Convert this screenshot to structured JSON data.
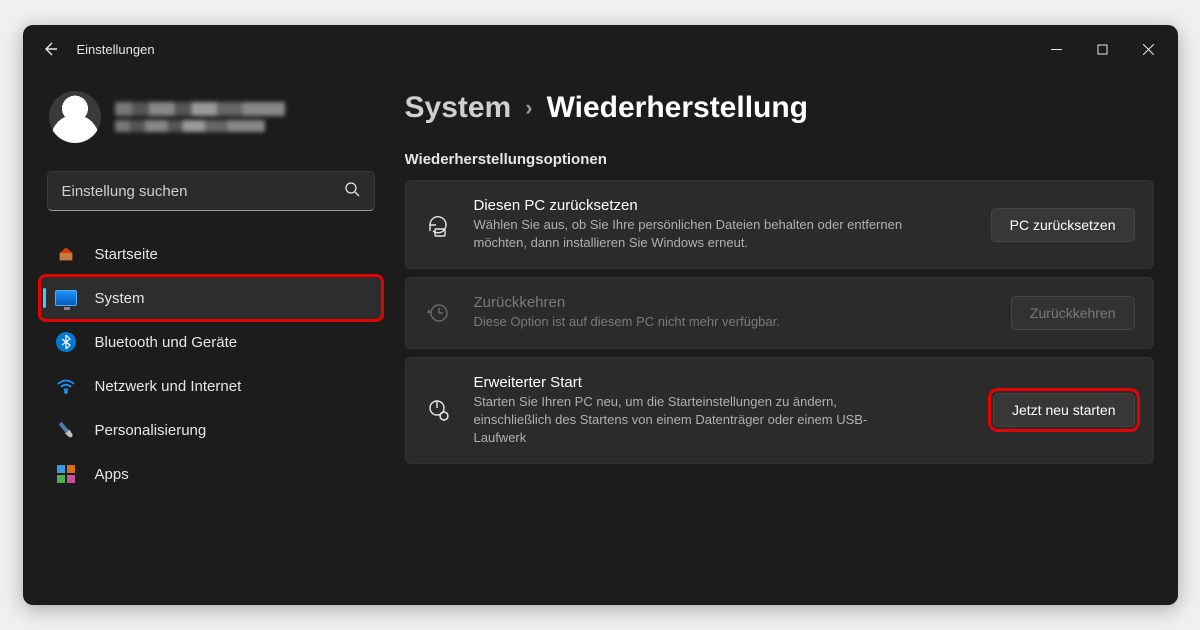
{
  "app": {
    "title": "Einstellungen"
  },
  "search": {
    "placeholder": "Einstellung suchen"
  },
  "nav": {
    "home": "Startseite",
    "system": "System",
    "bluetooth": "Bluetooth und Geräte",
    "network": "Netzwerk und Internet",
    "personalization": "Personalisierung",
    "apps": "Apps"
  },
  "breadcrumb": {
    "parent": "System",
    "current": "Wiederherstellung"
  },
  "section": {
    "title": "Wiederherstellungsoptionen"
  },
  "cards": {
    "reset": {
      "title": "Diesen PC zurücksetzen",
      "desc": "Wählen Sie aus, ob Sie Ihre persönlichen Dateien behalten oder entfernen möchten, dann installieren Sie Windows erneut.",
      "button": "PC zurücksetzen"
    },
    "goback": {
      "title": "Zurückkehren",
      "desc": "Diese Option ist auf diesem PC nicht mehr verfügbar.",
      "button": "Zurückkehren"
    },
    "advanced": {
      "title": "Erweiterter Start",
      "desc": "Starten Sie Ihren PC neu, um die Starteinstellungen zu ändern, einschließlich des Startens von einem Datenträger oder einem USB-Laufwerk",
      "button": "Jetzt neu starten"
    }
  }
}
